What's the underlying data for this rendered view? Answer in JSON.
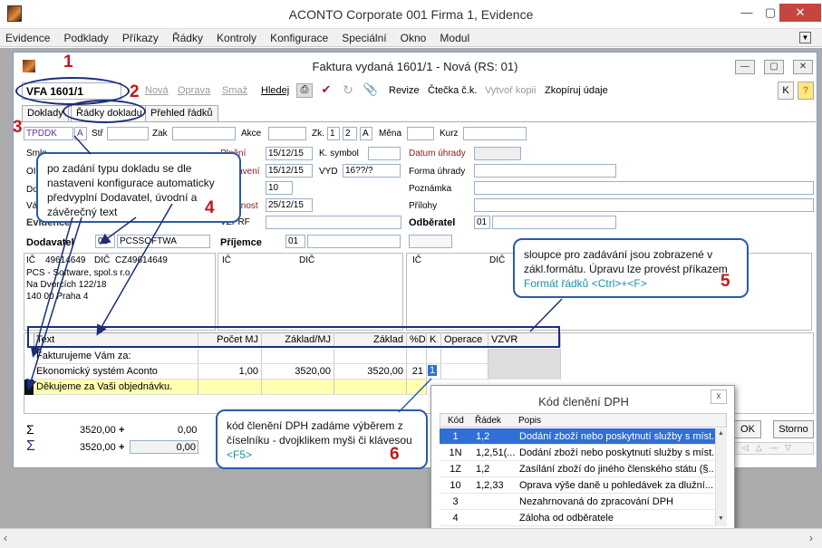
{
  "window": {
    "title": "ACONTO Corporate 001 Firma 1, Evidence",
    "minimize": "—",
    "restore": "▢",
    "close": "✕"
  },
  "menu": [
    "Evidence",
    "Podklady",
    "Příkazy",
    "Řádky",
    "Kontroly",
    "Konfigurace",
    "Speciální",
    "Okno",
    "Modul"
  ],
  "child": {
    "title": "Faktura vydaná 1601/1 - Nová  (RS: 01)"
  },
  "toolbar": {
    "doc_number": "VFA 1601/1",
    "nova": "Nová",
    "oprava": "Oprava",
    "smaz": "Smaž",
    "hledej": "Hledej",
    "revize": "Revize",
    "ctecka": "Čtečka č.k.",
    "vytvor": "Vytvoř kopii",
    "zkopiruj": "Zkopíruj údaje",
    "k": "K",
    "help": "?"
  },
  "tabs": [
    "Doklady",
    "Řádky dokladu",
    "Přehled řádků"
  ],
  "header_row": {
    "tpddk": "TPDDK",
    "a": "A",
    "str": "Stř",
    "zak": "Zak",
    "akce": "Akce",
    "zk": "Zk.",
    "zk1": "1",
    "zk2": "2",
    "zka": "A",
    "mena": "Měna",
    "kurz": "Kurz"
  },
  "form": {
    "smlouva": "Smlo",
    "o": "OI",
    "d": "Do",
    "v": "Vá",
    "plneni_label": "Plnění",
    "plneni": "15/12/15",
    "ksymbol_label": "K. symbol",
    "vystaveni_label": "Vystavení",
    "vystaveni": "15/12/15",
    "vyd_label": "VYD",
    "vyd": "16??/?",
    "splatnost_dni": "10",
    "splatnost_label": "Splatnost",
    "splatnost": "25/12/15",
    "vzprf": "VZPRF",
    "datum_uhrady": "Datum úhrady",
    "forma_uhrady": "Forma úhrady",
    "poznamka": "Poznámka",
    "prilohy": "Přílohy",
    "evidence_label": "Evidence",
    "odberatel_label": "Odběratel",
    "odberatel": "01",
    "dodavatel_label": "Dodavatel",
    "dodavatel_code": "01",
    "dodavatel_name": "PCSSOFTWA",
    "prijemce_label": "Příjemce",
    "prijemce": "01",
    "ic": "IČ",
    "dic": "DIČ",
    "dod_ic": "49614649",
    "dod_dic": "CZ49614649",
    "dod_addr": [
      "PCS - Software, spol.s r.o.",
      "Na Dvorcích 122/18",
      "140 00 Praha 4"
    ]
  },
  "grid": {
    "columns": [
      "Text",
      "Počet MJ",
      "Základ/MJ",
      "Základ",
      "%D",
      "K",
      "Operace",
      "VZVR"
    ],
    "rows": [
      {
        "text": "Fakturujeme Vám za:",
        "pocet": "",
        "zakladmj": "",
        "zaklad": "",
        "d": "",
        "k": ""
      },
      {
        "text": "Ekonomický systém Aconto",
        "pocet": "1,00",
        "zakladmj": "3520,00",
        "zaklad": "3520,00",
        "d": "21",
        "k": "1"
      },
      {
        "text": "Děkujeme za Vaši objednávku.",
        "pocet": "",
        "zakladmj": "",
        "zaklad": "",
        "d": "",
        "k": ""
      }
    ]
  },
  "sums": {
    "sigma": "Σ",
    "s1": "3520,00",
    "s1b": "0,00",
    "s2": "3520,00",
    "s2b": "0,00",
    "plus": "+"
  },
  "buttons": {
    "ok": "OK",
    "storno": "Storno"
  },
  "popup": {
    "title": "Kód členění DPH",
    "close": "x",
    "columns": [
      "Kód",
      "Řádek",
      "Popis"
    ],
    "rows": [
      {
        "kod": "1",
        "radek": "1,2",
        "popis": "Dodání zboží nebo poskytnutí služby s míst..."
      },
      {
        "kod": "1N",
        "radek": "1,2,51(...",
        "popis": "Dodání zboží nebo poskytnutí služby s míst..."
      },
      {
        "kod": "1Z",
        "radek": "1,2",
        "popis": "Zasílání zboží do jiného členského státu (§..."
      },
      {
        "kod": "10",
        "radek": "1,2,33",
        "popis": "Oprava výše daně u pohledávek za dlužní..."
      },
      {
        "kod": "3",
        "radek": "",
        "popis": "Nezahrnovaná do zpracování DPH"
      },
      {
        "kod": "4",
        "radek": "",
        "popis": "Záloha od odběratele"
      }
    ]
  },
  "callouts": {
    "c4": "po zadání typu dokladu se dle nastavení konfigurace automaticky předvyplní Dodavatel, úvodní a závěrečný text",
    "c5a": "sloupce pro zadávání jsou zobrazené v zákl.formátu. Úpravu lze provést příkazem ",
    "c5b": "Formát řádků <Ctrl>+<F>",
    "c6a": "kód členění DPH zadáme výběrem z číselníku -  dvojklikem myši či klávesou ",
    "c6b": "<F5>"
  },
  "numbers": [
    "1",
    "2",
    "3",
    "4",
    "5",
    "6"
  ],
  "colors": {
    "accent": "#2f6fd6",
    "marker": "#c2191a",
    "callout_border": "#2a5aa8",
    "highlight_row": "#ffffb0"
  }
}
